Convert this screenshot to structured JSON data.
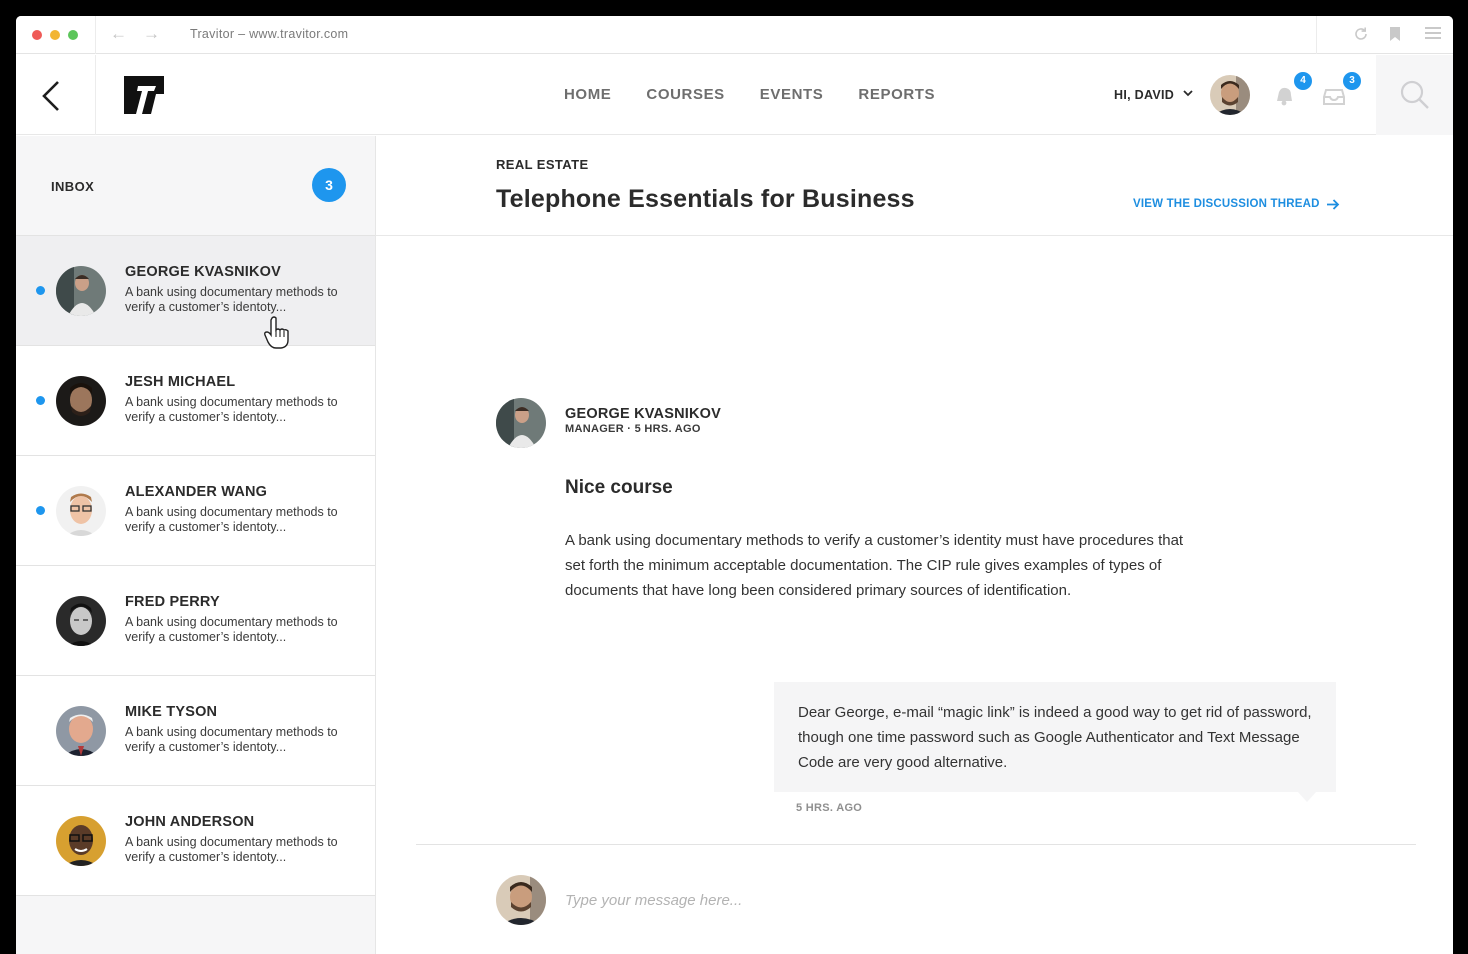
{
  "browser": {
    "url_text": "Travitor – www.travitor.com"
  },
  "header": {
    "nav": [
      "HOME",
      "COURSES",
      "EVENTS",
      "REPORTS"
    ],
    "greeting": "HI, DAVID",
    "notifications_count": "4",
    "inbox_count": "3"
  },
  "sidebar": {
    "title": "INBOX",
    "badge": "3",
    "conversations": [
      {
        "name": "GEORGE KVASNIKOV",
        "preview": "A bank using documentary methods to verify a customer’s identoty...",
        "unread": true,
        "active": true
      },
      {
        "name": "JESH MICHAEL",
        "preview": "A bank using documentary methods to verify a customer’s identoty...",
        "unread": true,
        "active": false
      },
      {
        "name": "ALEXANDER WANG",
        "preview": "A bank using documentary methods to verify a customer’s identoty...",
        "unread": true,
        "active": false
      },
      {
        "name": "FRED PERRY",
        "preview": "A bank using documentary methods to verify a customer’s identoty...",
        "unread": false,
        "active": false
      },
      {
        "name": "MIKE TYSON",
        "preview": "A bank using documentary methods to verify a customer’s identoty...",
        "unread": false,
        "active": false
      },
      {
        "name": "JOHN ANDERSON",
        "preview": "A bank using documentary methods to verify a customer’s identoty...",
        "unread": false,
        "active": false
      }
    ]
  },
  "thread": {
    "category": "REAL ESTATE",
    "title": "Telephone Essentials for Business",
    "link_label": "VIEW THE DISCUSSION THREAD",
    "author": "GEORGE KVASNIKOV",
    "author_meta": "MANAGER · 5 HRS. AGO",
    "message_title": "Nice course",
    "message_body": "A bank using documentary methods to verify a customer’s identity must have procedures that set forth the minimum acceptable documentation. The CIP rule gives examples of types of documents that have long been considered primary sources of identification.",
    "reply_body": "Dear George, e-mail “magic link” is indeed a good way to get rid of password, though one time password such as Google Authenticator and Text Message Code are very good alternative.",
    "reply_time": "5 HRS. AGO"
  },
  "composer": {
    "placeholder": "Type your message here..."
  },
  "colors": {
    "accent": "#1e96ee",
    "sidebar_bg": "#f6f6f7"
  }
}
